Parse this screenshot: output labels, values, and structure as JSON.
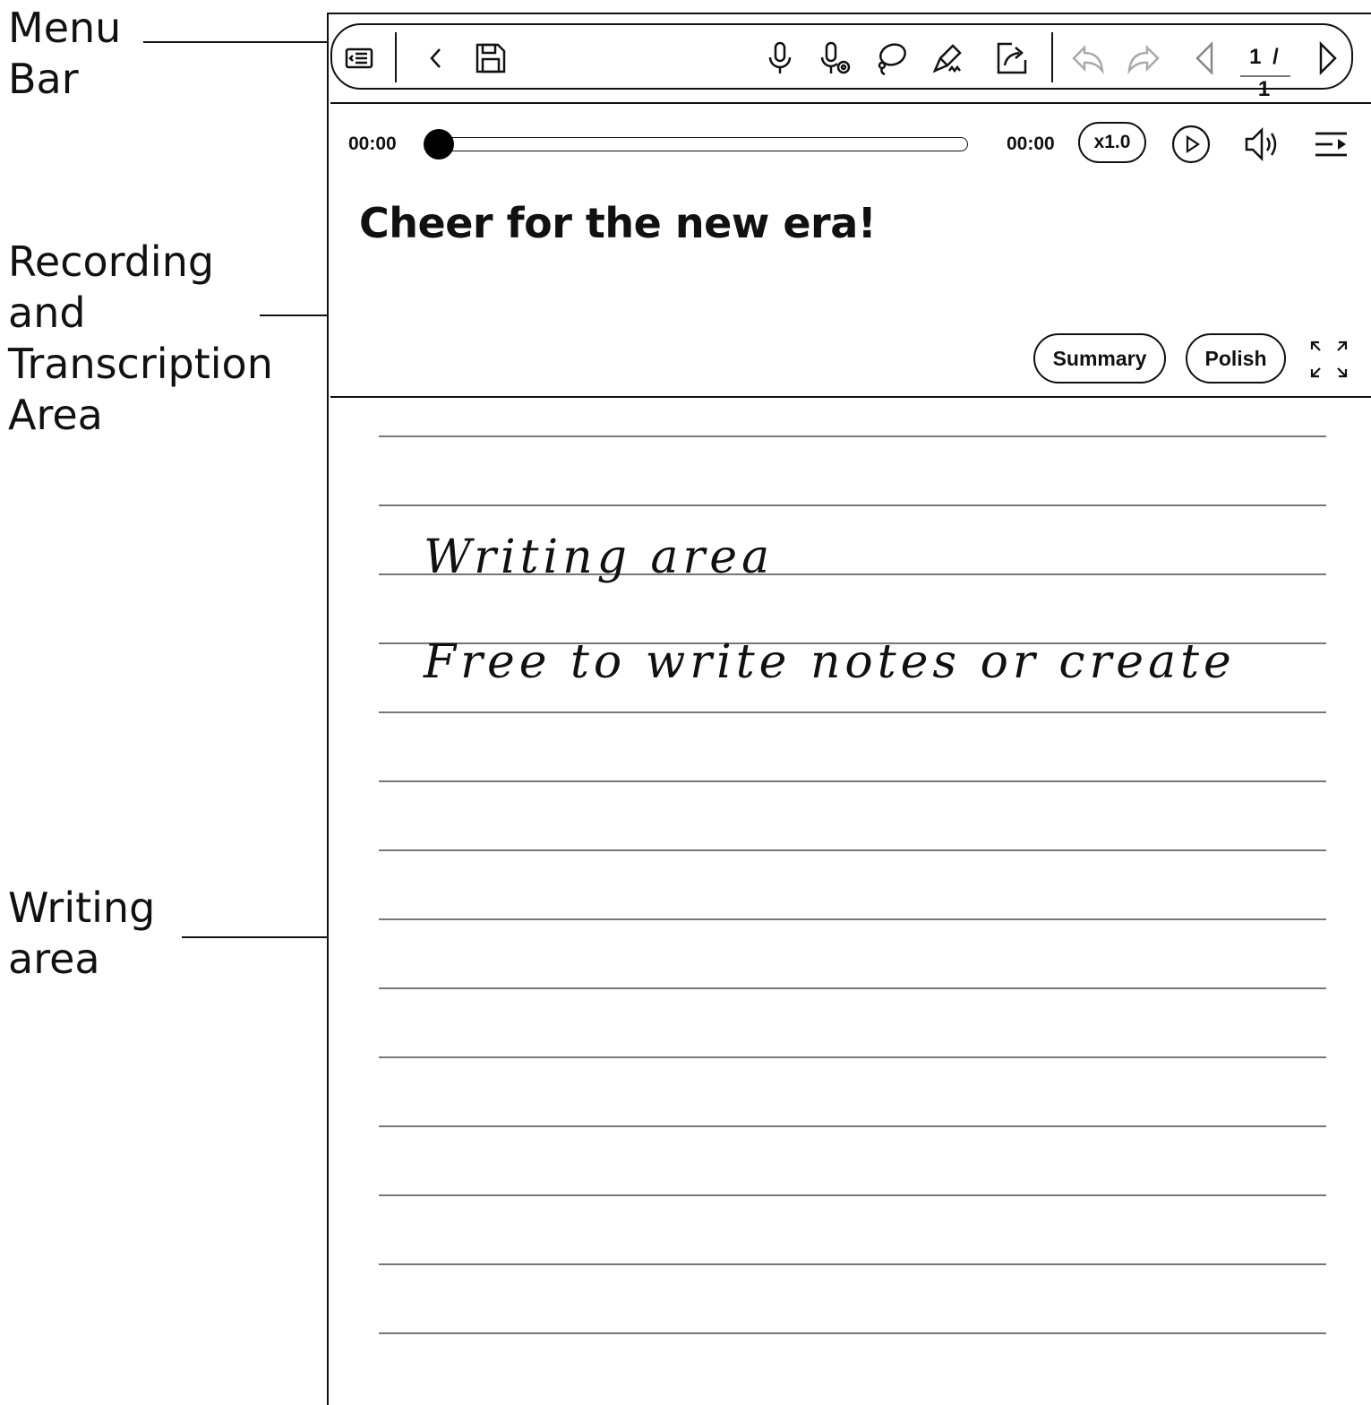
{
  "callouts": {
    "menu_bar": "Menu\nBar",
    "recording": "Recording\nand\nTranscription\nArea",
    "writing": "Writing\narea"
  },
  "menu_bar": {
    "icons": [
      "toc-icon",
      "back-icon",
      "save-icon",
      "microphone-icon",
      "record-settings-icon",
      "lasso-icon",
      "eraser-icon",
      "share-icon",
      "undo-icon",
      "redo-icon",
      "prev-page-icon",
      "next-page-icon"
    ],
    "page_indicator": "1 / 1"
  },
  "recording": {
    "current_time": "00:00",
    "total_time": "00:00",
    "progress": 0,
    "speed": "x1.0",
    "transcript": "Cheer for the new era!",
    "summary_label": "Summary",
    "polish_label": "Polish"
  },
  "writing_area": {
    "lines": [
      "Writing area",
      "Free to write notes or create"
    ]
  }
}
